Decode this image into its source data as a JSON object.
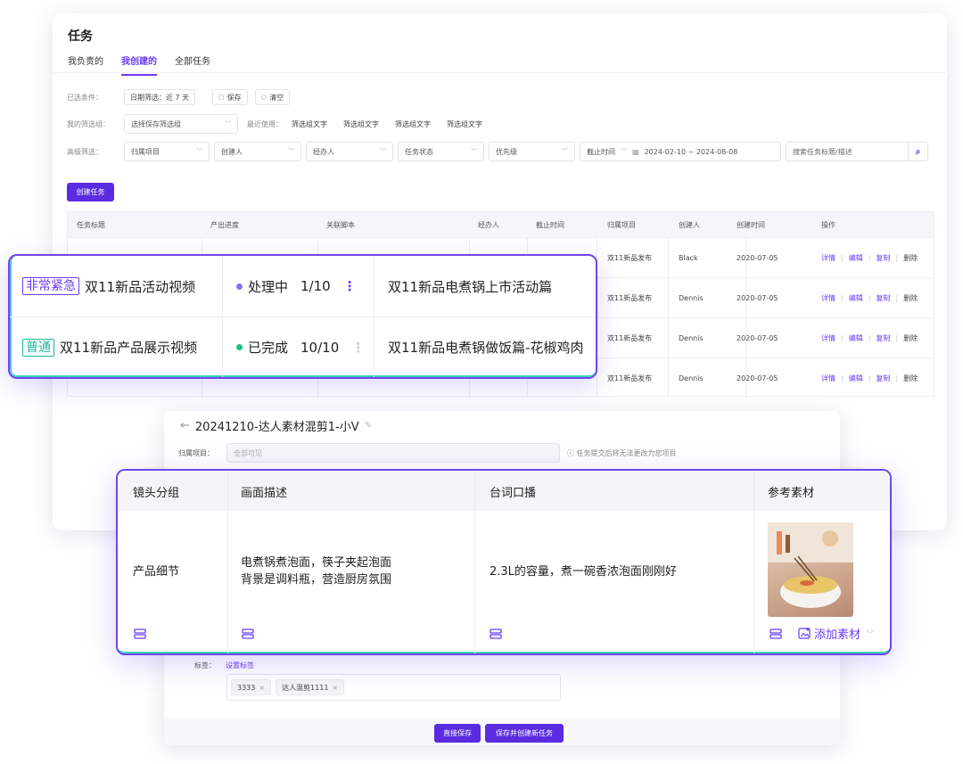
{
  "page": {
    "title": "任务"
  },
  "tabs": [
    {
      "label": "我负责的"
    },
    {
      "label": "我创建的"
    },
    {
      "label": "全部任务"
    }
  ],
  "filters": {
    "selected_label": "已选条件：",
    "date_chip": "日期筛选：近 7 天",
    "save": "保存",
    "clear": "清空",
    "my_groups_label": "我的筛选组：",
    "group_select_placeholder": "选择保存筛选组",
    "recent_label": "最近使用：",
    "recent": [
      "筛选组文字",
      "筛选组文字",
      "筛选组文字",
      "筛选组文字"
    ],
    "advanced_label": "高级筛选：",
    "project": "归属项目",
    "creator": "创建人",
    "handler": "经办人",
    "status": "任务状态",
    "priority": "优先级",
    "deadline": "截止时间",
    "date_range": "2024-02-10 ~ 2024-08-08",
    "search_placeholder": "搜索任务标题/描述"
  },
  "create_button": "创建任务",
  "table": {
    "columns": [
      "任务标题",
      "产出进度",
      "关联脚本",
      "经办人",
      "截止时间",
      "归属项目",
      "创建人",
      "创建时间",
      "操作"
    ],
    "rows": [
      {
        "project": "双11新品发布",
        "creator": "Black",
        "created": "2020-07-05"
      },
      {
        "project": "双11新品发布",
        "creator": "Dennis",
        "created": "2020-07-05"
      },
      {
        "project": "双11新品发布",
        "creator": "Dennis",
        "created": "2020-07-05"
      },
      {
        "project": "双11新品发布",
        "creator": "Dennis",
        "created": "2020-07-05"
      }
    ],
    "actions": [
      "详情",
      "编辑",
      "复制",
      "删除"
    ]
  },
  "overlay_rows": [
    {
      "tag": "非常紧急",
      "title": "双11新品活动视频",
      "status": "处理中",
      "progress": "1/10",
      "script": "双11新品电煮锅上市活动篇",
      "status_color": "#8a6df2",
      "tag_kind": "urgent"
    },
    {
      "tag": "普通",
      "title": "双11新品产品展示视频",
      "status": "已完成",
      "progress": "10/10",
      "script": "双11新品电煮锅做饭篇-花椒鸡肉",
      "status_color": "#19c37d",
      "tag_kind": "normal"
    }
  ],
  "editor": {
    "title": "20241210-达人素材混剪1-小V",
    "project_label": "归属项目：",
    "project_value": "全部可见",
    "hint": "任务提交后将无法更改为您项目",
    "tags_label": "标签：",
    "set_tags": "设置标签",
    "tags": [
      "3333",
      "达人混剪1111"
    ],
    "save_direct": "直接保存",
    "save_create": "保存并创建新任务"
  },
  "storyboard": {
    "columns": [
      "镜头分组",
      "画面描述",
      "台词口播",
      "参考素材"
    ],
    "shot_group": "产品细节",
    "description_lines": [
      "电煮锅煮泡面，筷子夹起泡面",
      "背景是调料瓶，营造厨房氛围"
    ],
    "voiceover": "2.3L的容量，煮一碗香浓泡面刚刚好",
    "add_material": "添加素材",
    "accent": "#6b3cf5"
  }
}
